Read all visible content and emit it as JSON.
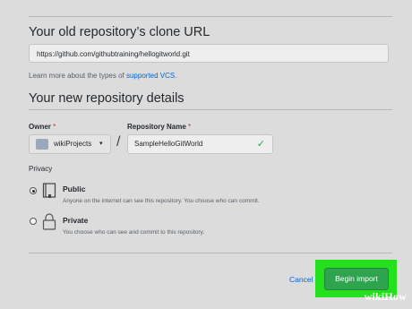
{
  "clone": {
    "title": "Your old repository’s clone URL",
    "url_value": "https://github.com/githubtraining/hellogitworld.git",
    "learn_prefix": "Learn more about the types of ",
    "learn_link": "supported VCS",
    "learn_suffix": "."
  },
  "details": {
    "title": "Your new repository details",
    "owner_label": "Owner",
    "owner_value": "wikiProjects",
    "repo_label": "Repository Name",
    "repo_value": "SampleHelloGitWorld",
    "required_mark": "*",
    "slash": "/"
  },
  "privacy": {
    "label": "Privacy",
    "options": [
      {
        "title": "Public",
        "desc": "Anyone on the internet can see this repository. You choose who can commit.",
        "selected": true
      },
      {
        "title": "Private",
        "desc": "You choose who can see and commit to this repository.",
        "selected": false
      }
    ]
  },
  "actions": {
    "cancel_label": "Cancel",
    "begin_label": "Begin import"
  },
  "watermark": "wikiHow",
  "colors": {
    "accent_green": "#2ea44f",
    "highlight": "#25e01c",
    "link_blue": "#0366d6"
  }
}
